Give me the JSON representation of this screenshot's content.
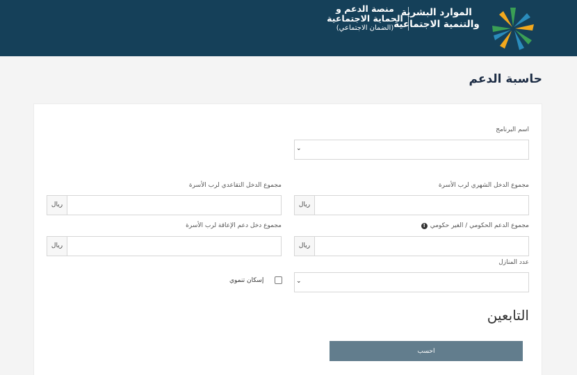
{
  "header": {
    "ministry_line1": "الموارد البشرية",
    "ministry_line2": "والتنمية الاجتماعية",
    "platform_line1": "منصة الدعم و",
    "platform_line2": "الحماية الاجتماعية",
    "platform_sub": "(الضمان الاجتماعي)"
  },
  "page": {
    "title": "حاسبة الدعم"
  },
  "form": {
    "program_label": "اسم البرنامج",
    "monthly_income_label": "مجموع الدخل الشهري لرب الأسرة",
    "retirement_income_label": "مجموع الدخل التقاعدي لرب الأسرة",
    "gov_support_label": "مجموع الدعم الحكومي / الغير حكومي",
    "disability_income_label": "مجموع دخل دعم الإعاقة لرب الأسرة",
    "houses_label": "عدد المنازل",
    "housing_checkbox_label": "إسكان تنموي",
    "currency": "ريال",
    "dependents_title": "التابعين",
    "calculate_label": "احسب"
  },
  "colors": {
    "header_bg": "#154059",
    "button_bg": "#627d8d"
  }
}
